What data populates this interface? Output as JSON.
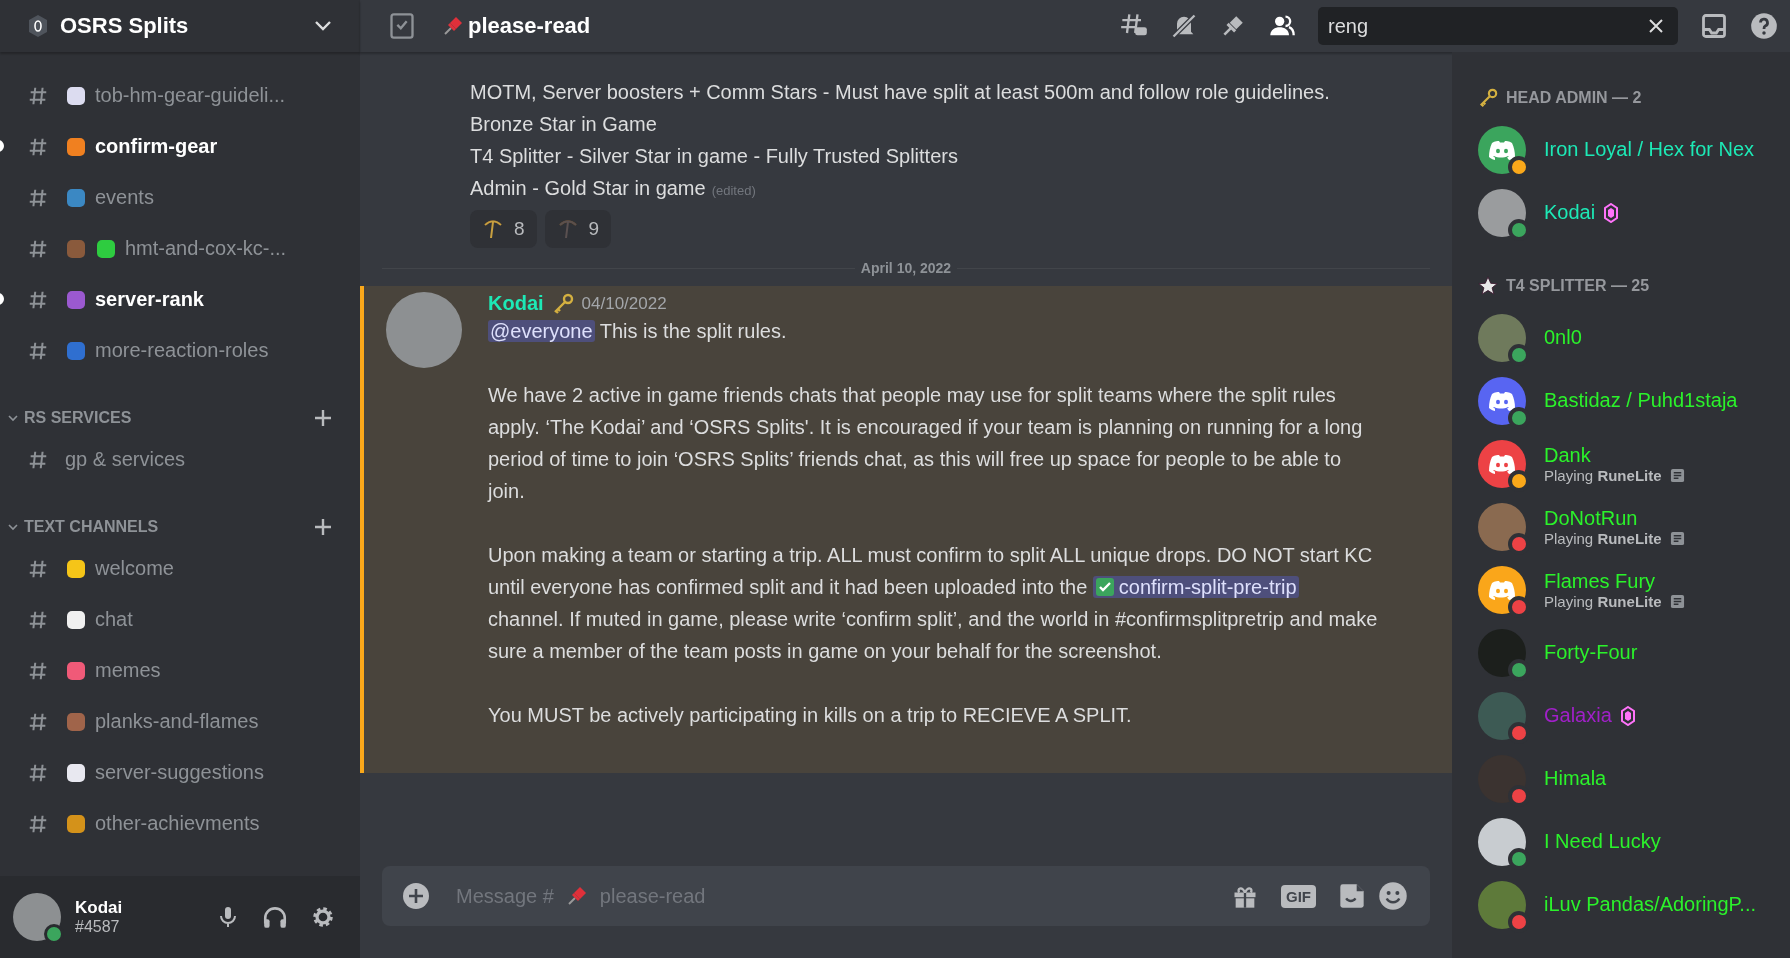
{
  "server": {
    "name": "OSRS Splits"
  },
  "sidebar": {
    "channels_top": [
      {
        "name": "tob-hm-gear-guideli...",
        "unread": false
      },
      {
        "name": "confirm-gear",
        "unread": true
      },
      {
        "name": "events",
        "unread": false
      },
      {
        "name": "hmt-and-cox-kc-...",
        "unread": false
      },
      {
        "name": "server-rank",
        "unread": true
      },
      {
        "name": "more-reaction-roles",
        "unread": false
      }
    ],
    "categories": [
      {
        "name": "RS SERVICES",
        "expanded": true,
        "channels": [
          {
            "name": "gp & services",
            "unread": false
          }
        ]
      },
      {
        "name": "TEXT CHANNELS",
        "expanded": true,
        "channels": [
          {
            "name": "welcome",
            "unread": false
          },
          {
            "name": "chat",
            "unread": false
          },
          {
            "name": "memes",
            "unread": false
          },
          {
            "name": "planks-and-flames",
            "unread": false
          },
          {
            "name": "server-suggestions",
            "unread": false
          },
          {
            "name": "other-achievments",
            "unread": false
          }
        ]
      }
    ]
  },
  "user_panel": {
    "name": "Kodai",
    "tag": "#4587",
    "status": {
      "color": "#3ba55d"
    }
  },
  "header": {
    "channel": "please-read",
    "search": {
      "value": "reng"
    }
  },
  "messages_prev": {
    "lines": [
      "MOTM, Server boosters + Comm Stars - Must have split at least 500m and follow role guidelines. Bronze Star in Game",
      "T4 Splitter - Silver Star in game - Fully Trusted Splitters",
      "Admin - Gold Star in game"
    ],
    "edited": "(edited)",
    "reactions": [
      {
        "count": "8"
      },
      {
        "count": "9"
      }
    ]
  },
  "date_divider": "April 10, 2022",
  "message": {
    "author": {
      "name": "Kodai",
      "color": "#1de9b6"
    },
    "timestamp": "04/10/2022",
    "highlighted": true,
    "paragraphs": [
      [
        {
          "kind": "mention",
          "text": "@everyone"
        },
        {
          "kind": "text",
          "text": " This is the split rules."
        }
      ],
      [
        {
          "kind": "text",
          "text": "We have 2 active in game friends chats that people may use for split teams where the split rules apply. ‘The Kodai’ and ‘OSRS Splits'. It is encouraged if your team is planning on running for a long period of time to join ‘OSRS Splits’ friends chat, as this will free up space for people to be able to join."
        }
      ],
      [
        {
          "kind": "text",
          "text": "Upon making a team or starting a trip. ALL must confirm to split ALL unique drops. DO NOT start KC until everyone has confirmed split and it had been uploaded into the "
        },
        {
          "kind": "channel",
          "text": "confirm-split-pre-trip"
        },
        {
          "kind": "text",
          "text": " channel. If muted in game, please write ‘confirm split’, and the world in #confirmsplitpretrip and make sure a member of the team posts in game on your behalf for the screenshot."
        }
      ],
      [
        {
          "kind": "text",
          "text": "You MUST be actively participating in kills on a trip to RECIEVE A SPLIT."
        }
      ]
    ]
  },
  "composer": {
    "placeholder_before": "Message #",
    "placeholder_after": "please-read",
    "gif_label": "GIF"
  },
  "members": {
    "groups": [
      {
        "role": "HEAD ADMIN — 2",
        "members": [
          {
            "name": "Iron Loyal / Hex for Nex",
            "color": "#1de9b6",
            "status": {
              "color": "#faa81a"
            },
            "avatar": {
              "kind": "logo",
              "color": "#3ba55d"
            },
            "booster": false
          },
          {
            "name": "Kodai",
            "color": "#1de9b6",
            "status": {
              "color": "#3ba55d"
            },
            "avatar": {
              "kind": "photo",
              "color": "#9a9c9e"
            },
            "booster": true
          }
        ]
      },
      {
        "role": "T4 SPLITTER — 25",
        "members": [
          {
            "name": "0nl0",
            "color": "#2bf22b",
            "status": {
              "color": "#3ba55d"
            },
            "avatar": {
              "kind": "photo",
              "color": "#6f7a5c"
            },
            "booster": false
          },
          {
            "name": "Bastidaz / Puhd1staja",
            "color": "#2bf22b",
            "status": {
              "color": "#3ba55d"
            },
            "avatar": {
              "kind": "logo",
              "color": "#5865f2"
            },
            "booster": false
          },
          {
            "name": "Dank",
            "color": "#2bf22b",
            "status": {
              "color": "#faa81a"
            },
            "avatar": {
              "kind": "logo",
              "color": "#ed4245"
            },
            "booster": false,
            "activity_prefix": "Playing",
            "activity": "RuneLite"
          },
          {
            "name": "DoNotRun",
            "color": "#2bf22b",
            "status": {
              "color": "#ed4245"
            },
            "avatar": {
              "kind": "photo",
              "color": "#8a6a50"
            },
            "booster": false,
            "activity_prefix": "Playing",
            "activity": "RuneLite"
          },
          {
            "name": "Flames Fury",
            "color": "#2bf22b",
            "status": {
              "color": "#ed4245"
            },
            "avatar": {
              "kind": "logo",
              "color": "#faa61a"
            },
            "booster": false,
            "activity_prefix": "Playing",
            "activity": "RuneLite"
          },
          {
            "name": "Forty-Four",
            "color": "#2bf22b",
            "status": {
              "color": "#3ba55d"
            },
            "avatar": {
              "kind": "photo",
              "color": "#1c1f1c"
            },
            "booster": false
          },
          {
            "name": "Galaxia",
            "color": "#a020c8",
            "status": {
              "color": "#ed4245"
            },
            "avatar": {
              "kind": "photo",
              "color": "#3d5a54"
            },
            "booster": true
          },
          {
            "name": "Himala",
            "color": "#2bf22b",
            "status": {
              "color": "#ed4245"
            },
            "avatar": {
              "kind": "photo",
              "color": "#3b3330"
            },
            "booster": false
          },
          {
            "name": "I Need Lucky",
            "color": "#2bf22b",
            "status": {
              "color": "#3ba55d"
            },
            "avatar": {
              "kind": "photo",
              "color": "#c8ccd0"
            },
            "booster": false
          },
          {
            "name": "iLuv Pandas/AdoringP...",
            "color": "#2bf22b",
            "status": {
              "color": "#ed4245"
            },
            "avatar": {
              "kind": "photo",
              "color": "#5e7a3a"
            },
            "booster": false
          }
        ]
      }
    ]
  }
}
